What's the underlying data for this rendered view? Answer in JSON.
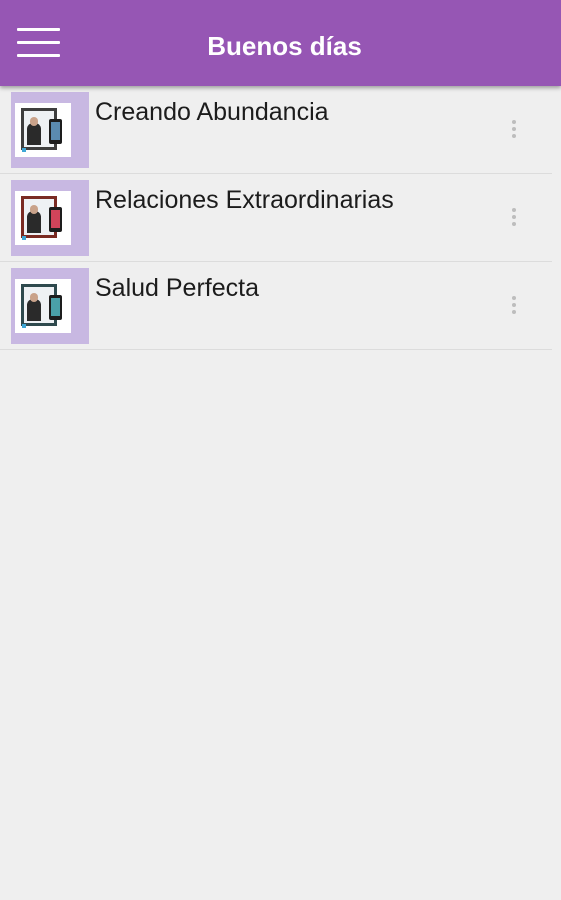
{
  "app_bar": {
    "title": "Buenos días",
    "menu_icon": "hamburger-menu-icon",
    "background_color": "#9656b4"
  },
  "list": {
    "items": [
      {
        "title": "Creando Abundancia",
        "thumbnail": "book-cover-thumbnail",
        "more_icon": "more-vert-icon"
      },
      {
        "title": "Relaciones Extraordinarias",
        "thumbnail": "book-cover-thumbnail",
        "more_icon": "more-vert-icon"
      },
      {
        "title": "Salud Perfecta",
        "thumbnail": "book-cover-thumbnail",
        "more_icon": "more-vert-icon"
      }
    ]
  },
  "colors": {
    "accent": "#9656b4",
    "thumbnail_bg": "#c8b8e2",
    "page_bg": "#efefef"
  }
}
